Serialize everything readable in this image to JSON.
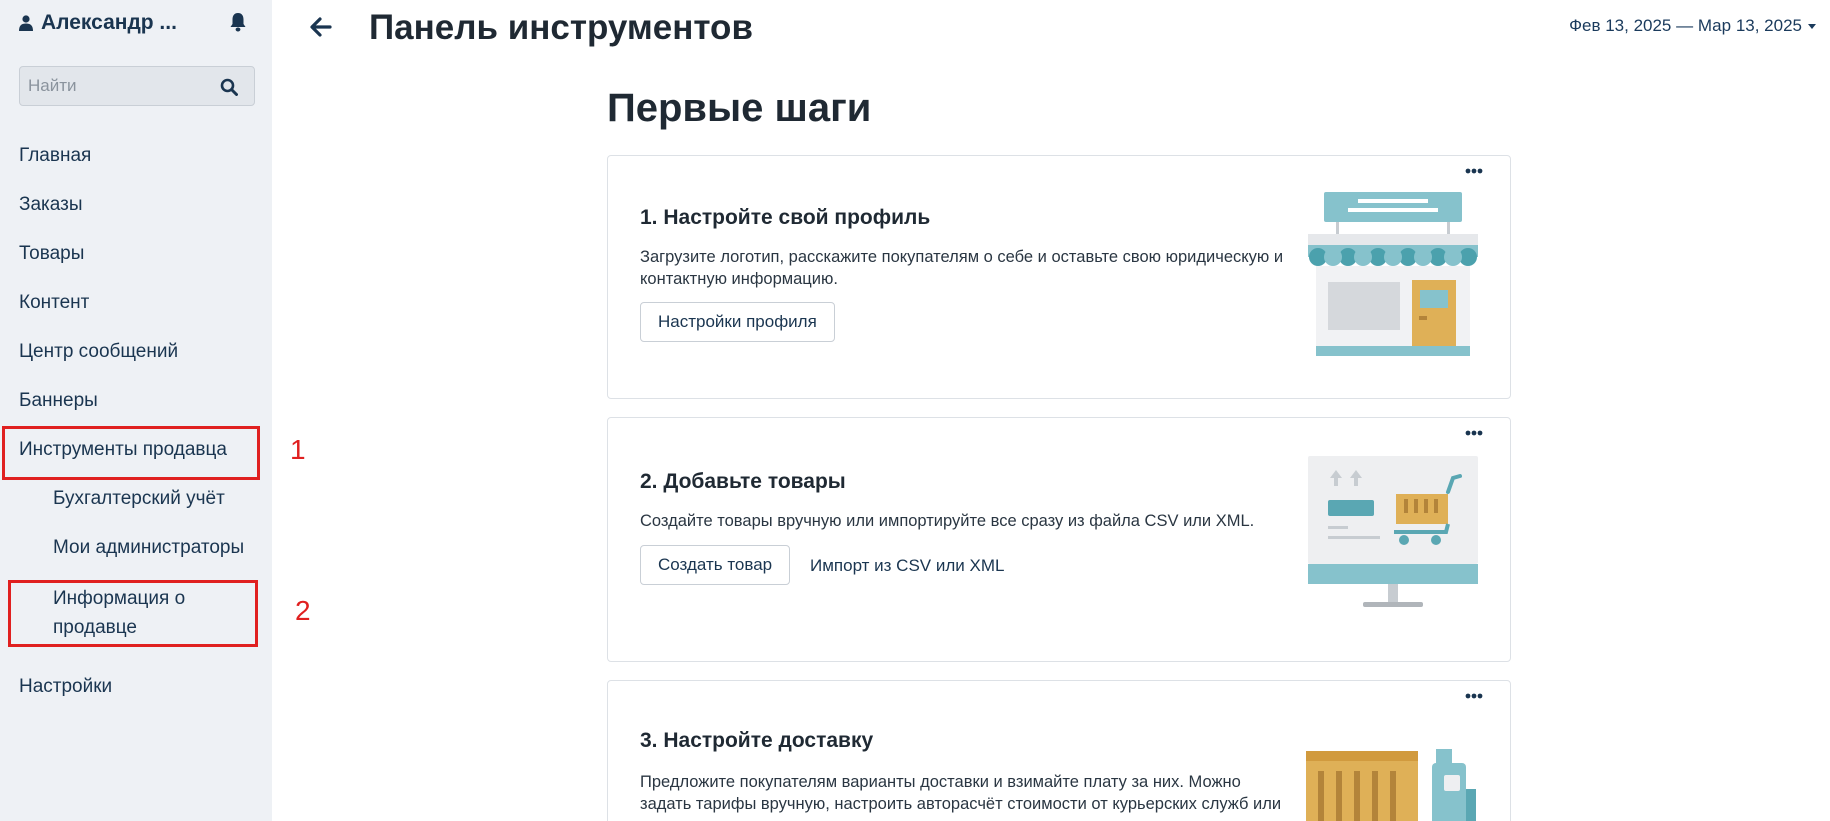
{
  "sidebar": {
    "user_name": "Александр ...",
    "search_placeholder": "Найти",
    "nav": {
      "home": "Главная",
      "orders": "Заказы",
      "products": "Товары",
      "content": "Контент",
      "messages": "Центр сообщений",
      "banners": "Баннеры",
      "seller_tools": "Инструменты продавца",
      "accounting": "Бухгалтерский учёт",
      "admins": "Мои администраторы",
      "seller_info": "Информация о продавце",
      "settings": "Настройки"
    },
    "annotations": [
      "1",
      "2"
    ],
    "annotation_color": "#e02020"
  },
  "header": {
    "title": "Панель инструментов",
    "date_range": "Фев 13, 2025 — Мар 13, 2025"
  },
  "main": {
    "section_title": "Первые шаги",
    "cards": [
      {
        "title": "1. Настройте свой профиль",
        "description": "Загрузите логотип, расскажите покупателям о себе и оставьте свою юридическую и контактную информацию.",
        "button": "Настройки профиля",
        "illustration": "store-front-icon"
      },
      {
        "title": "2. Добавьте товары",
        "description": "Создайте товары вручную или импортируйте все сразу из файла CSV или XML.",
        "button": "Создать товар",
        "link": "Импорт из CSV или XML",
        "illustration": "monitor-cart-icon"
      },
      {
        "title": "3. Настройте доставку",
        "description": "Предложите покупателям варианты доставки и взимайте плату за них. Можно задать тарифы вручную, настроить авторасчёт стоимости от курьерских служб или самовывоз.",
        "illustration": "delivery-truck-icon"
      }
    ]
  },
  "colors": {
    "sidebar_bg": "#eef1f5",
    "accent": "#86c2cc",
    "brand_text": "#1a3550"
  }
}
